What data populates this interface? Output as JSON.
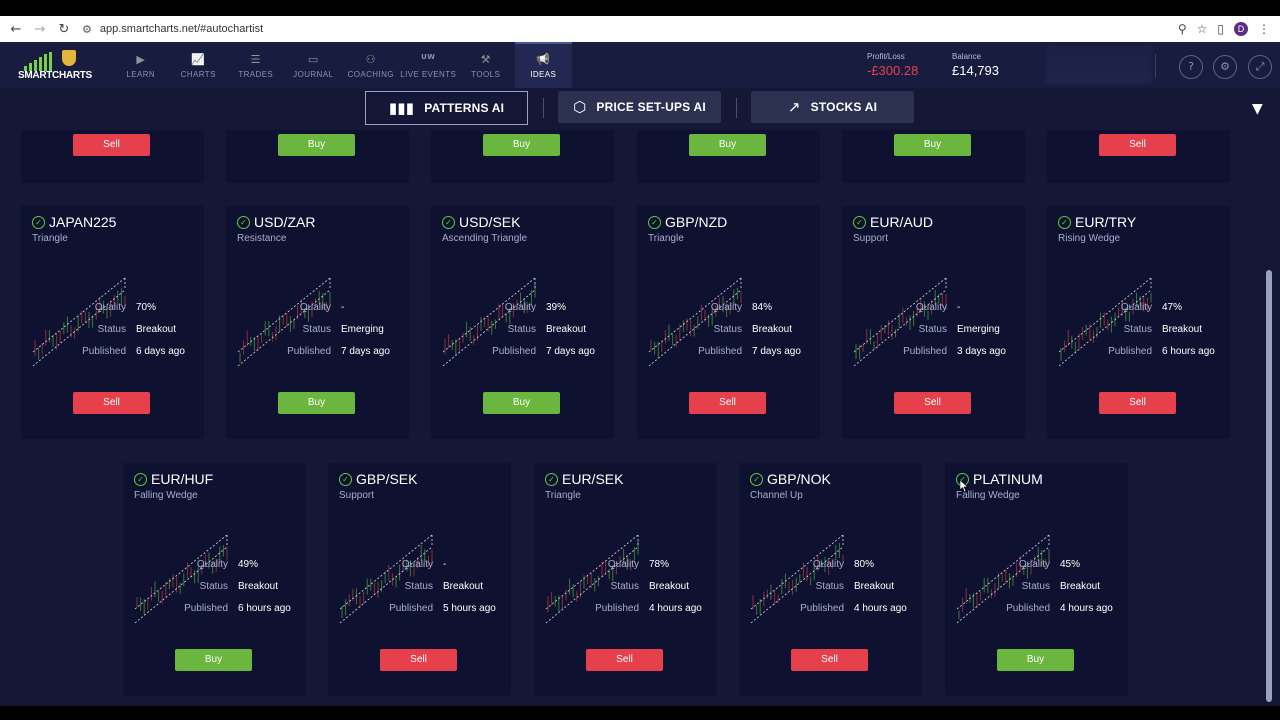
{
  "browser": {
    "url": "app.smartcharts.net/#autochartist",
    "profile_initial": "D"
  },
  "app": {
    "logo_text": "SMARTCHARTS",
    "nav": [
      {
        "label": "LEARN",
        "icon": "play-circle-icon"
      },
      {
        "label": "CHARTS",
        "icon": "chart-icon"
      },
      {
        "label": "TRADES",
        "icon": "list-icon"
      },
      {
        "label": "JOURNAL",
        "icon": "journal-icon"
      },
      {
        "label": "COACHING",
        "icon": "coaching-icon"
      },
      {
        "label": "LIVE EVENTS",
        "icon": "live-icon",
        "badge": "UW"
      },
      {
        "label": "TOOLS",
        "icon": "tools-icon"
      },
      {
        "label": "IDEAS",
        "icon": "megaphone-icon",
        "active": true
      }
    ],
    "profit_loss": {
      "label": "Profit/Loss",
      "value": "-£300.28"
    },
    "balance": {
      "label": "Balance",
      "value": "£14,793"
    }
  },
  "tabs": {
    "patterns": "PATTERNS AI",
    "price_setups": "PRICE SET-UPS AI",
    "stocks": "STOCKS AI"
  },
  "labels": {
    "quality": "Quality",
    "status": "Status",
    "published": "Published"
  },
  "colors": {
    "buy": "#6ab63e",
    "sell": "#e5404b",
    "loss": "#e8414d"
  },
  "top_partial_row": [
    {
      "action": "Sell"
    },
    {
      "action": "Buy"
    },
    {
      "action": "Buy"
    },
    {
      "action": "Buy"
    },
    {
      "action": "Buy"
    },
    {
      "action": "Sell"
    }
  ],
  "cards_row1": [
    {
      "symbol": "JAPAN225",
      "pattern": "Triangle",
      "quality": "70%",
      "status": "Breakout",
      "published": "6 days ago",
      "action": "Sell"
    },
    {
      "symbol": "USD/ZAR",
      "pattern": "Resistance",
      "quality": "-",
      "status": "Emerging",
      "published": "7 days ago",
      "action": "Buy"
    },
    {
      "symbol": "USD/SEK",
      "pattern": "Ascending Triangle",
      "quality": "39%",
      "status": "Breakout",
      "published": "7 days ago",
      "action": "Buy"
    },
    {
      "symbol": "GBP/NZD",
      "pattern": "Triangle",
      "quality": "84%",
      "status": "Breakout",
      "published": "7 days ago",
      "action": "Sell"
    },
    {
      "symbol": "EUR/AUD",
      "pattern": "Support",
      "quality": "-",
      "status": "Emerging",
      "published": "3 days ago",
      "action": "Sell"
    },
    {
      "symbol": "EUR/TRY",
      "pattern": "Rising Wedge",
      "quality": "47%",
      "status": "Breakout",
      "published": "6 hours ago",
      "action": "Sell"
    }
  ],
  "cards_row2": [
    {
      "symbol": "EUR/HUF",
      "pattern": "Falling Wedge",
      "quality": "49%",
      "status": "Breakout",
      "published": "6 hours ago",
      "action": "Buy"
    },
    {
      "symbol": "GBP/SEK",
      "pattern": "Support",
      "quality": "-",
      "status": "Breakout",
      "published": "5 hours ago",
      "action": "Sell"
    },
    {
      "symbol": "EUR/SEK",
      "pattern": "Triangle",
      "quality": "78%",
      "status": "Breakout",
      "published": "4 hours ago",
      "action": "Sell"
    },
    {
      "symbol": "GBP/NOK",
      "pattern": "Channel Up",
      "quality": "80%",
      "status": "Breakout",
      "published": "4 hours ago",
      "action": "Sell"
    },
    {
      "symbol": "PLATINUM",
      "pattern": "Falling Wedge",
      "quality": "45%",
      "status": "Breakout",
      "published": "4 hours ago",
      "action": "Buy"
    }
  ]
}
